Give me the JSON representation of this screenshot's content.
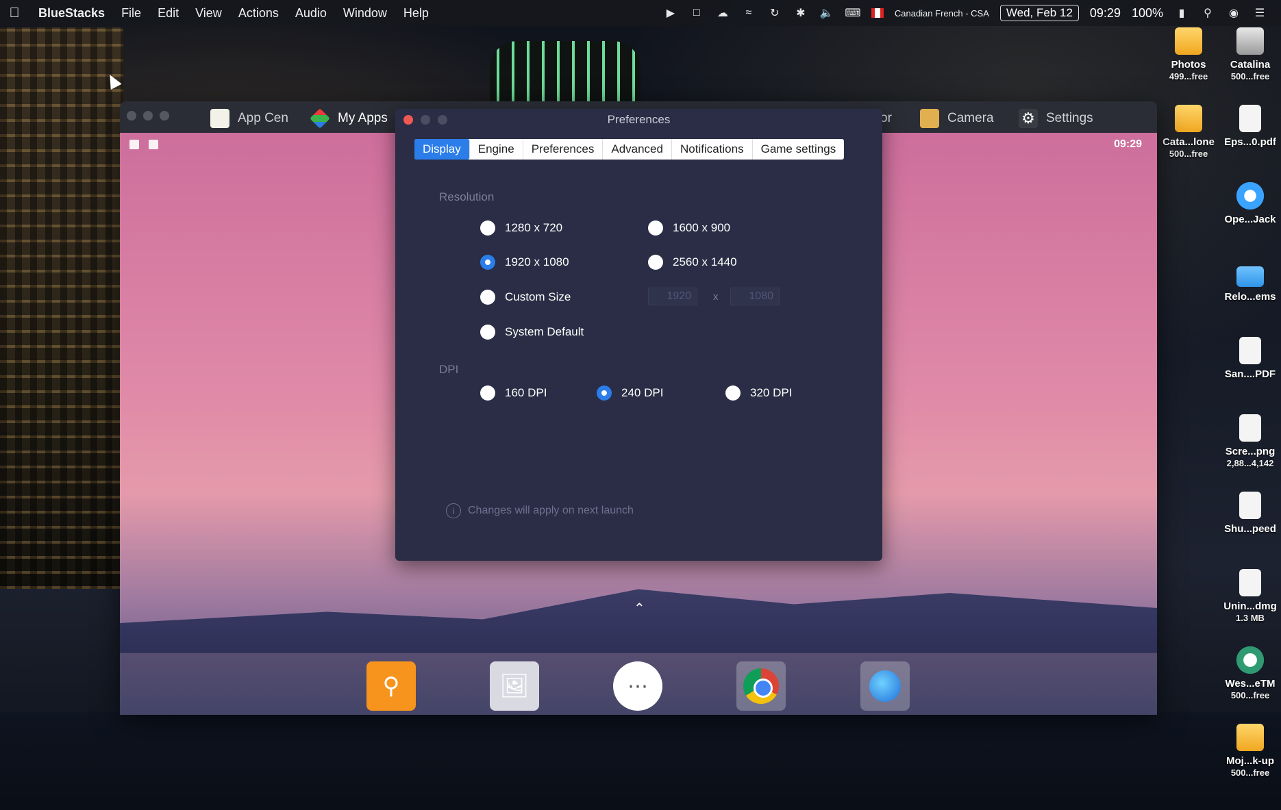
{
  "menubar": {
    "app_name": "BlueStacks",
    "menus": [
      "File",
      "Edit",
      "View",
      "Actions",
      "Audio",
      "Window",
      "Help"
    ],
    "keyboard_layout": "Canadian French - CSA",
    "date": "Wed, Feb 12",
    "time": "09:29",
    "battery": "100%"
  },
  "desktop_icons": [
    {
      "name": "Photos",
      "sub": "499...free",
      "icon": "drive-icon"
    },
    {
      "name": "Catalina",
      "sub": "500...free",
      "icon": "disk-icon"
    },
    {
      "name": "Cata...lone",
      "sub": "500...free",
      "icon": "drive-icon"
    },
    {
      "name": "Eps...0.pdf",
      "sub": "",
      "icon": "document-icon"
    },
    {
      "name": "Ope...Jack",
      "sub": "",
      "icon": "app-icon"
    },
    {
      "name": "Relo...ems",
      "sub": "",
      "icon": "folder-icon"
    },
    {
      "name": "San....PDF",
      "sub": "",
      "icon": "document-icon"
    },
    {
      "name": "Scre...png",
      "sub": "2,88...4,142",
      "icon": "image-icon"
    },
    {
      "name": "Shu...peed",
      "sub": "",
      "icon": "document-icon"
    },
    {
      "name": "Unin...dmg",
      "sub": "1.3 MB",
      "icon": "disk-image-icon"
    },
    {
      "name": "Wes...eTM",
      "sub": "500...free",
      "icon": "time-machine-icon"
    },
    {
      "name": "Moj...k-up",
      "sub": "500...free",
      "icon": "drive-icon"
    }
  ],
  "bluestacks": {
    "tabs": [
      {
        "label": "App Cen"
      },
      {
        "label": "My Apps"
      },
      {
        "label": "Camera"
      },
      {
        "label": "Settings"
      }
    ],
    "partial_tab_text": "or",
    "android_time": "09:29",
    "dock_apps": [
      "search-app",
      "gallery-app",
      "app-drawer",
      "chrome-app",
      "browser-app"
    ]
  },
  "preferences": {
    "title": "Preferences",
    "tabs": [
      "Display",
      "Engine",
      "Preferences",
      "Advanced",
      "Notifications",
      "Game settings"
    ],
    "active_tab": "Display",
    "resolution_label": "Resolution",
    "resolutions": [
      {
        "label": "1280 x 720",
        "selected": false
      },
      {
        "label": "1600 x 900",
        "selected": false
      },
      {
        "label": "1920 x 1080",
        "selected": true
      },
      {
        "label": "2560 x 1440",
        "selected": false
      },
      {
        "label": "Custom Size",
        "selected": false
      },
      {
        "label": "System Default",
        "selected": false
      }
    ],
    "custom_width": "1920",
    "custom_height": "1080",
    "custom_sep": "x",
    "dpi_label": "DPI",
    "dpis": [
      {
        "label": "160 DPI",
        "selected": false
      },
      {
        "label": "240 DPI",
        "selected": true
      },
      {
        "label": "320 DPI",
        "selected": false
      }
    ],
    "note": "Changes will apply on next launch"
  },
  "colors": {
    "accent": "#2b7de9",
    "dialog_bg": "#2a2d45",
    "close_red": "#ee5a52"
  }
}
